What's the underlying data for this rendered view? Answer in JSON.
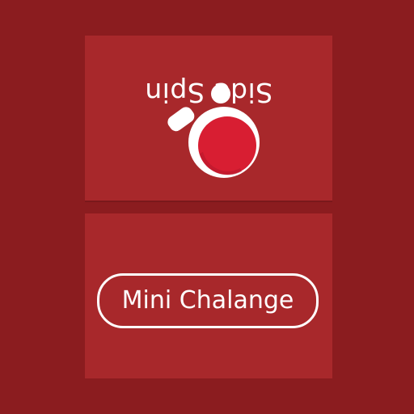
{
  "colors": {
    "background": "#8b1c1f",
    "panel": "#a8282b",
    "paddle_face": "#d81e32",
    "text": "#ffffff"
  },
  "top_panel": {
    "title": "Side Spin",
    "icon": "ping-pong-paddle-icon"
  },
  "bottom_panel": {
    "button_label": "Mini Chalange"
  }
}
